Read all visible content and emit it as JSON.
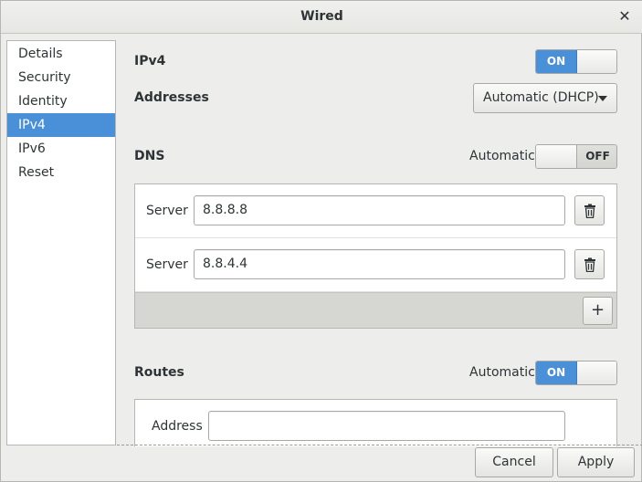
{
  "window": {
    "title": "Wired",
    "close_glyph": "✕"
  },
  "sidebar": {
    "items": [
      {
        "label": "Details"
      },
      {
        "label": "Security"
      },
      {
        "label": "Identity"
      },
      {
        "label": "IPv4",
        "selected": true
      },
      {
        "label": "IPv6"
      },
      {
        "label": "Reset"
      }
    ]
  },
  "ipv4": {
    "label": "IPv4",
    "switch_state": "ON"
  },
  "addresses": {
    "label": "Addresses",
    "method": "Automatic (DHCP)"
  },
  "dns": {
    "label": "DNS",
    "automatic_label": "Automatic",
    "switch_state": "OFF",
    "servers": [
      {
        "label": "Server",
        "value": "8.8.8.8"
      },
      {
        "label": "Server",
        "value": "8.8.4.4"
      }
    ],
    "add_glyph": "+"
  },
  "routes": {
    "label": "Routes",
    "automatic_label": "Automatic",
    "switch_state": "ON",
    "address_label": "Address",
    "address_value": ""
  },
  "buttons": {
    "cancel": "Cancel",
    "apply": "Apply"
  },
  "icons": {
    "delete": "trash-icon",
    "add": "plus-icon",
    "close": "close-icon",
    "dropdown": "chevron-down-icon"
  },
  "colors": {
    "accent": "#4a90d9",
    "background": "#ededeb"
  }
}
